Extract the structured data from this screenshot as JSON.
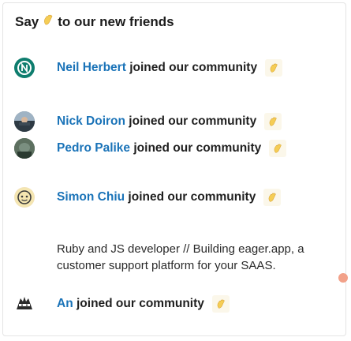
{
  "header": {
    "prefix": "Say",
    "emoji_icon": "waving-hand-icon",
    "suffix": "to our new friends"
  },
  "members": [
    {
      "name": "Neil Herbert",
      "action": "joined our community",
      "avatar": "avatar-teal-letter"
    },
    {
      "name": "Nick Doiron",
      "action": "joined our community",
      "avatar": "avatar-photo"
    },
    {
      "name": "Pedro Palike",
      "action": "joined our community",
      "avatar": "avatar-photo"
    },
    {
      "name": "Simon Chiu",
      "action": "joined our community",
      "avatar": "avatar-illustration",
      "bio": "Ruby and JS developer // Building eager.app, a customer support platform for your SAAS."
    },
    {
      "name": "An",
      "action": "joined our community",
      "avatar": "avatar-ninja"
    }
  ],
  "colors": {
    "link": "#1a73b8",
    "teal_avatar": "#0e7d6e",
    "notification_dot": "#f2a189"
  }
}
